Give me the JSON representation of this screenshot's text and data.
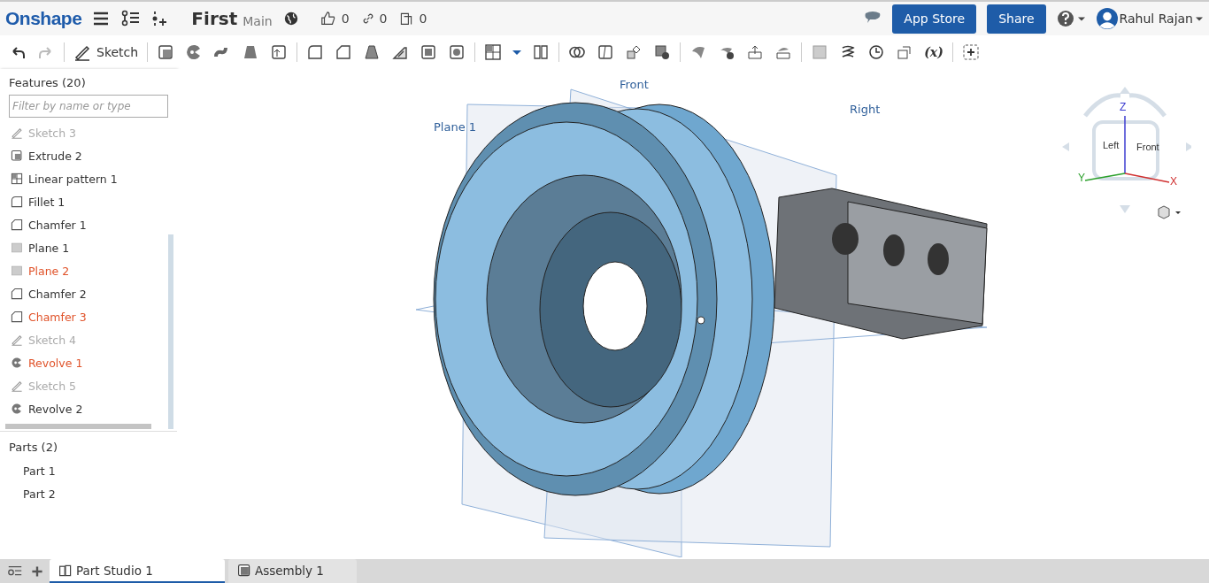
{
  "header": {
    "logo": "Onshape",
    "title": "First",
    "branch": "Main",
    "counts": [
      {
        "kind": "likes",
        "value": "0"
      },
      {
        "kind": "links",
        "value": "0"
      },
      {
        "kind": "copies",
        "value": "0"
      }
    ],
    "buttons": [
      "App Store",
      "Share"
    ],
    "user": "Rahul Rajan"
  },
  "toolbar": {
    "sketch_label": "Sketch",
    "formula": "(x)"
  },
  "features": {
    "title": "Features (20)",
    "placeholder": "Filter by name or type",
    "items": [
      {
        "name": "Sketch 3",
        "kind": "sketch",
        "suppressed": true,
        "error": false
      },
      {
        "name": "Extrude 2",
        "kind": "extrude",
        "suppressed": false,
        "error": false
      },
      {
        "name": "Linear pattern 1",
        "kind": "pattern",
        "suppressed": false,
        "error": false
      },
      {
        "name": "Fillet 1",
        "kind": "fillet",
        "suppressed": false,
        "error": false
      },
      {
        "name": "Chamfer 1",
        "kind": "chamfer",
        "suppressed": false,
        "error": false
      },
      {
        "name": "Plane 1",
        "kind": "plane",
        "suppressed": false,
        "error": false
      },
      {
        "name": "Plane 2",
        "kind": "plane",
        "suppressed": false,
        "error": true
      },
      {
        "name": "Chamfer 2",
        "kind": "chamfer",
        "suppressed": false,
        "error": false
      },
      {
        "name": "Chamfer 3",
        "kind": "chamfer",
        "suppressed": false,
        "error": true
      },
      {
        "name": "Sketch 4",
        "kind": "sketch",
        "suppressed": true,
        "error": false
      },
      {
        "name": "Revolve 1",
        "kind": "revolve",
        "suppressed": false,
        "error": true
      },
      {
        "name": "Sketch 5",
        "kind": "sketch",
        "suppressed": true,
        "error": false
      },
      {
        "name": "Revolve 2",
        "kind": "revolve",
        "suppressed": false,
        "error": false
      }
    ]
  },
  "parts": {
    "title": "Parts (2)",
    "items": [
      "Part 1",
      "Part 2"
    ]
  },
  "viewport": {
    "plane_labels": [
      "Plane 1",
      "Front",
      "Right"
    ],
    "view_cube": {
      "faces": [
        "Left",
        "Front"
      ],
      "axes": [
        "Z",
        "Y",
        "X"
      ]
    }
  },
  "tabs": [
    {
      "label": "Part Studio 1",
      "kind": "partstudio",
      "selected": true
    },
    {
      "label": "Assembly 1",
      "kind": "assembly",
      "selected": false
    }
  ]
}
